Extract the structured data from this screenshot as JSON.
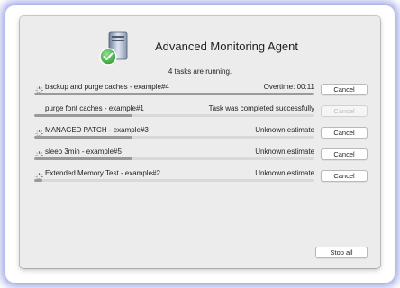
{
  "window": {
    "title": "Advanced Monitoring Agent",
    "summary": "4 tasks are running."
  },
  "tasks": [
    {
      "name": "backup and purge caches - example#4",
      "status": "Overtime: 00:11",
      "progress": 1.0,
      "spinning": true,
      "button": "Cancel",
      "button_enabled": true
    },
    {
      "name": "purge font caches - example#1",
      "status": "Task was completed successfully",
      "progress": 0.35,
      "spinning": false,
      "button": "Cancel",
      "button_enabled": false
    },
    {
      "name": "MANAGED PATCH - example#3",
      "status": "Unknown estimate",
      "progress": 0.35,
      "spinning": true,
      "button": "Cancel",
      "button_enabled": true
    },
    {
      "name": "sleep 3min - example#5",
      "status": "Unknown estimate",
      "progress": 0.35,
      "spinning": true,
      "button": "Cancel",
      "button_enabled": true
    },
    {
      "name": "Extended Memory Test - example#2",
      "status": "Unknown estimate",
      "progress": 0.03,
      "spinning": true,
      "button": "Cancel",
      "button_enabled": true
    }
  ],
  "footer": {
    "stop_all_label": "Stop all"
  },
  "icons": {
    "app": "computer-checkmark-icon",
    "spinner": "spinner-icon"
  },
  "colors": {
    "check_green": "#3aa53a",
    "progress_fill": "#9a9a9a",
    "glow": "#3c50c8"
  }
}
